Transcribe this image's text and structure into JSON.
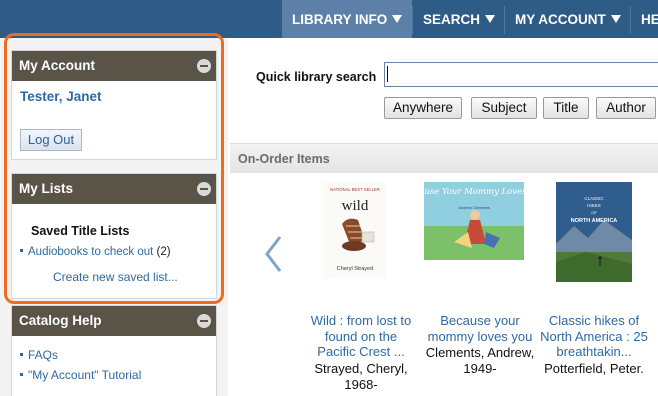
{
  "nav": {
    "items": [
      {
        "label": "LIBRARY INFO"
      },
      {
        "label": "SEARCH"
      },
      {
        "label": "MY ACCOUNT"
      },
      {
        "label": "HE"
      }
    ]
  },
  "sidebar": {
    "account": {
      "title": "My Account",
      "user_name": "Tester, Janet",
      "logout_label": "Log Out"
    },
    "lists": {
      "title": "My Lists",
      "heading": "Saved Title Lists",
      "items": [
        {
          "label": "Audiobooks to check out",
          "count": "(2)"
        }
      ],
      "create_label": "Create new saved list..."
    },
    "help": {
      "title": "Catalog Help",
      "items": [
        {
          "label": "FAQs"
        },
        {
          "label": "\"My Account\" Tutorial"
        }
      ]
    }
  },
  "search": {
    "label": "Quick library search",
    "value": "",
    "scopes": [
      "Anywhere",
      "Subject",
      "Title",
      "Author"
    ]
  },
  "on_order": {
    "title": "On-Order Items",
    "books": [
      {
        "title_lines": [
          "Wild : from lost to",
          "found on the",
          "Pacific Crest ..."
        ],
        "author_lines": [
          "Strayed, Cheryl,",
          "1968-"
        ],
        "cover": {
          "top_text": "NATIONAL BEST SELLER",
          "title": "wild",
          "author": "Cheryl Strayed"
        }
      },
      {
        "title_lines": [
          "Because your",
          "mommy loves you"
        ],
        "author_lines": [
          "Clements, Andrew,",
          "1949-"
        ],
        "cover": {
          "title": "Because Your Mommy Loves You",
          "author": "Andrew Clements"
        }
      },
      {
        "title_lines": [
          "Classic hikes of",
          "North America : 25",
          "breathtakin..."
        ],
        "author_lines": [
          "Potterfield, Peter."
        ],
        "cover": {
          "top": "CLASSIC",
          "middle": "HIKES",
          "sub": "OF",
          "bottom": "NORTH AMERICA"
        }
      }
    ]
  },
  "colors": {
    "nav_bg": "#2f5b87",
    "panel_header": "#5a5348",
    "link": "#2d6aa3",
    "highlight": "#ee6b22"
  }
}
